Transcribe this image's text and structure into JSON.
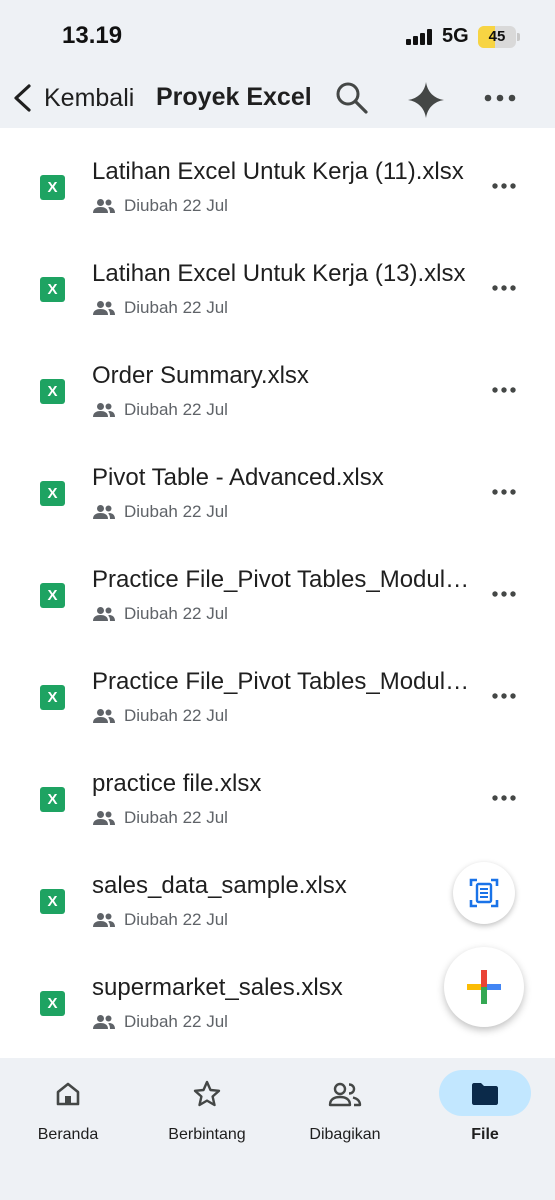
{
  "status": {
    "time": "13.19",
    "network": "5G",
    "battery": "45",
    "battery_level": 0.45
  },
  "header": {
    "back_label": "Kembali",
    "title": "Proyek Excel",
    "icons": [
      "chevron-left-icon",
      "search-icon",
      "gemini-spark-icon",
      "more-horizontal-icon"
    ]
  },
  "files": [
    {
      "name": "Latihan Excel Untuk Kerja (11).xlsx",
      "meta": "Diubah 22 Jul",
      "type_badge": "X"
    },
    {
      "name": "Latihan Excel Untuk Kerja (13).xlsx",
      "meta": "Diubah 22 Jul",
      "type_badge": "X"
    },
    {
      "name": "Order Summary.xlsx",
      "meta": "Diubah 22 Jul",
      "type_badge": "X"
    },
    {
      "name": "Pivot Table - Advanced.xlsx",
      "meta": "Diubah 22 Jul",
      "type_badge": "X"
    },
    {
      "name": "Practice File_Pivot Tables_Module.xlsx",
      "meta": "Diubah 22 Jul",
      "type_badge": "X"
    },
    {
      "name": "Practice File_Pivot Tables_Module.xlsx",
      "meta": "Diubah 22 Jul",
      "type_badge": "X"
    },
    {
      "name": "practice file.xlsx",
      "meta": "Diubah 22 Jul",
      "type_badge": "X"
    },
    {
      "name": "sales_data_sample.xlsx",
      "meta": "Diubah 22 Jul",
      "type_badge": "X"
    },
    {
      "name": "supermarket_sales.xlsx",
      "meta": "Diubah 22 Jul",
      "type_badge": "X"
    }
  ],
  "fabs": {
    "scan_icon": "document-scan-icon",
    "new_icon": "plus-multicolor-icon"
  },
  "nav": [
    {
      "label": "Beranda",
      "icon": "home-icon",
      "active": false
    },
    {
      "label": "Berbintang",
      "icon": "star-icon",
      "active": false
    },
    {
      "label": "Dibagikan",
      "icon": "people-icon",
      "active": false
    },
    {
      "label": "File",
      "icon": "folder-icon",
      "active": true
    }
  ],
  "colors": {
    "bar_background": "#eef1f5",
    "excel_green": "#1ea362",
    "active_pill": "#c2e7ff",
    "text_secondary": "#5f6368",
    "battery_fill": "#f7d443"
  }
}
